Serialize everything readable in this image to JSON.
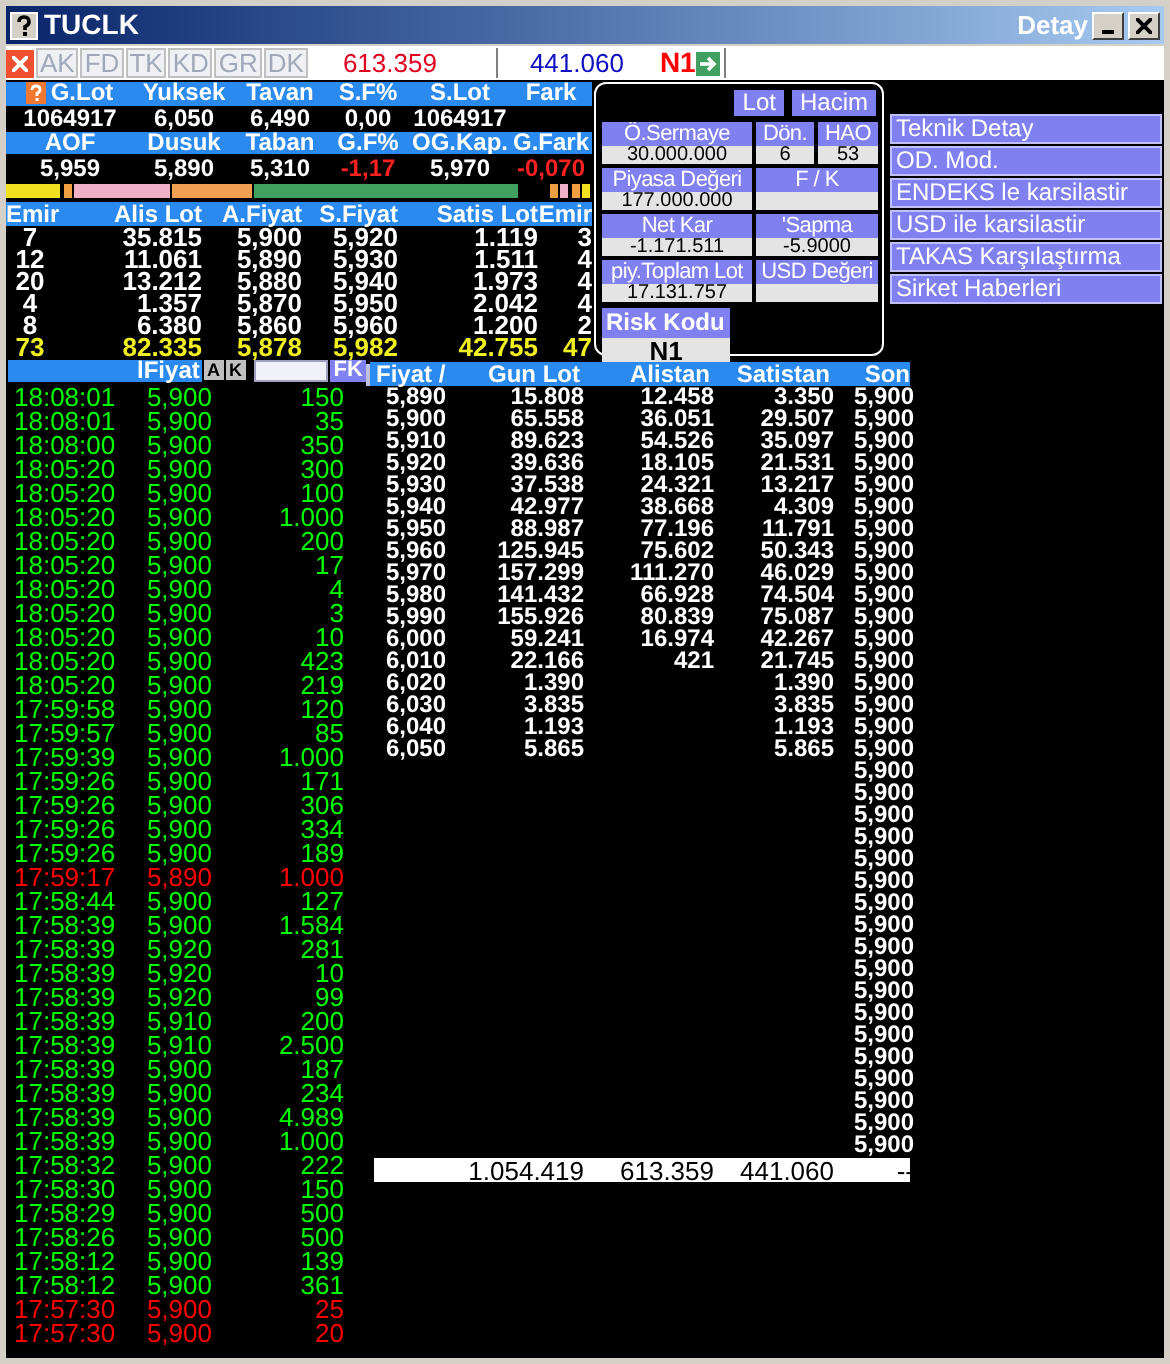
{
  "window": {
    "title": "TUCLK",
    "title_right": "Detay"
  },
  "toolbar": {
    "buttons": [
      {
        "label": "AK",
        "disabled": true
      },
      {
        "label": "FD",
        "disabled": true
      },
      {
        "label": "TK",
        "disabled": true
      },
      {
        "label": "KD",
        "disabled": true
      },
      {
        "label": "GR",
        "disabled": true
      },
      {
        "label": "DK",
        "disabled": true
      }
    ],
    "buy_total": "613.359",
    "sell_total": "441.060",
    "risk": "N1"
  },
  "stats_rows": [
    {
      "cells": [
        {
          "label": "G.Lot",
          "value": "1064917"
        },
        {
          "label": "Yuksek",
          "value": "6,050"
        },
        {
          "label": "Tavan",
          "value": "6,490"
        },
        {
          "label": "S.F%",
          "value": "0,00"
        },
        {
          "label": "S.Lot",
          "value": "1064917"
        },
        {
          "label": "Fark"
        }
      ]
    },
    {
      "cells": [
        {
          "label": "AOF",
          "value": "5,959",
          "color": "#ffffff"
        },
        {
          "label": "Dusuk",
          "value": "5,890",
          "color": "#ffffff"
        },
        {
          "label": "Taban",
          "value": "5,310",
          "color": "#ffffff"
        },
        {
          "label": "G.F%",
          "value": "-1,17",
          "color": "#ff2020"
        },
        {
          "label": "OG.Kap.",
          "value": "5,970",
          "color": "#ffffff"
        },
        {
          "label": "G.Fark",
          "value": "-0,070",
          "color": "#ff2020"
        }
      ]
    }
  ],
  "order_book": {
    "columns": [
      "Emir",
      "Alis Lot",
      "A.Fiyat",
      "S.Fiyat",
      "Satis Lot",
      "Emir"
    ],
    "rows": [
      {
        "kind": "level",
        "cells": [
          "7",
          "35.815",
          "5,900",
          "5,920",
          "1.119",
          "3"
        ]
      },
      {
        "kind": "level",
        "cells": [
          "12",
          "11.061",
          "5,890",
          "5,930",
          "1.511",
          "4"
        ]
      },
      {
        "kind": "level",
        "cells": [
          "20",
          "13.212",
          "5,880",
          "5,940",
          "1.973",
          "4"
        ]
      },
      {
        "kind": "level",
        "cells": [
          "4",
          "1.357",
          "5,870",
          "5,950",
          "2.042",
          "4"
        ]
      },
      {
        "kind": "level",
        "cells": [
          "8",
          "6.380",
          "5,860",
          "5,960",
          "1.200",
          "2"
        ]
      },
      {
        "kind": "total",
        "cells": [
          "73",
          "82.335",
          "5,878",
          "5,982",
          "42.755",
          "47"
        ]
      }
    ]
  },
  "detail_panel": {
    "toggles": [
      "Lot",
      "Hacim"
    ],
    "fields": [
      {
        "label": "Ö.Sermaye",
        "value": "30.000.000"
      },
      {
        "label": "Dön.",
        "value": "6"
      },
      {
        "label": "HAO",
        "value": "53"
      },
      {
        "label": "Piyasa Değeri",
        "value": "177.000.000"
      },
      {
        "label": "F / K"
      },
      {
        "label": "Net Kar",
        "value": "-1.171.511"
      },
      {
        "label": "'Sapma",
        "value": "-5.9000"
      },
      {
        "label": "piy.Toplam Lot",
        "value": "17.131.757"
      },
      {
        "label": "USD Değeri"
      }
    ],
    "risk": {
      "label": "Risk Kodu",
      "value": "N1"
    }
  },
  "menu": [
    "Teknik Detay",
    "OD. Mod.",
    "ENDEKS le karsilastir",
    "USD ile karsilastir",
    "TAKAS Karşılaştırma",
    "Sirket Haberleri"
  ],
  "trades": {
    "header": "lFiyat",
    "buttons": [
      "A",
      "K"
    ],
    "filter_button": "FK",
    "rows": [
      {
        "time": "18:08:01",
        "price": "5,900",
        "lot": "150",
        "color": "#00ff00"
      },
      {
        "time": "18:08:01",
        "price": "5,900",
        "lot": "35",
        "color": "#00ff00"
      },
      {
        "time": "18:08:00",
        "price": "5,900",
        "lot": "350",
        "color": "#00ff00"
      },
      {
        "time": "18:05:20",
        "price": "5,900",
        "lot": "300",
        "color": "#00ff00"
      },
      {
        "time": "18:05:20",
        "price": "5,900",
        "lot": "100",
        "color": "#00ff00"
      },
      {
        "time": "18:05:20",
        "price": "5,900",
        "lot": "1.000",
        "color": "#00ff00"
      },
      {
        "time": "18:05:20",
        "price": "5,900",
        "lot": "200",
        "color": "#00ff00"
      },
      {
        "time": "18:05:20",
        "price": "5,900",
        "lot": "17",
        "color": "#00ff00"
      },
      {
        "time": "18:05:20",
        "price": "5,900",
        "lot": "4",
        "color": "#00ff00"
      },
      {
        "time": "18:05:20",
        "price": "5,900",
        "lot": "3",
        "color": "#00ff00"
      },
      {
        "time": "18:05:20",
        "price": "5,900",
        "lot": "10",
        "color": "#00ff00"
      },
      {
        "time": "18:05:20",
        "price": "5,900",
        "lot": "423",
        "color": "#00ff00"
      },
      {
        "time": "18:05:20",
        "price": "5,900",
        "lot": "219",
        "color": "#00ff00"
      },
      {
        "time": "17:59:58",
        "price": "5,900",
        "lot": "120",
        "color": "#00ff00"
      },
      {
        "time": "17:59:57",
        "price": "5,900",
        "lot": "85",
        "color": "#00ff00"
      },
      {
        "time": "17:59:39",
        "price": "5,900",
        "lot": "1.000",
        "color": "#00ff00"
      },
      {
        "time": "17:59:26",
        "price": "5,900",
        "lot": "171",
        "color": "#00ff00"
      },
      {
        "time": "17:59:26",
        "price": "5,900",
        "lot": "306",
        "color": "#00ff00"
      },
      {
        "time": "17:59:26",
        "price": "5,900",
        "lot": "334",
        "color": "#00ff00"
      },
      {
        "time": "17:59:26",
        "price": "5,900",
        "lot": "189",
        "color": "#00ff00"
      },
      {
        "time": "17:59:17",
        "price": "5,890",
        "lot": "1.000",
        "color": "#ff0000"
      },
      {
        "time": "17:58:44",
        "price": "5,900",
        "lot": "127",
        "color": "#00ff00"
      },
      {
        "time": "17:58:39",
        "price": "5,900",
        "lot": "1.584",
        "color": "#00ff00"
      },
      {
        "time": "17:58:39",
        "price": "5,920",
        "lot": "281",
        "color": "#00ff00"
      },
      {
        "time": "17:58:39",
        "price": "5,920",
        "lot": "10",
        "color": "#00ff00"
      },
      {
        "time": "17:58:39",
        "price": "5,920",
        "lot": "99",
        "color": "#00ff00"
      },
      {
        "time": "17:58:39",
        "price": "5,910",
        "lot": "200",
        "color": "#00ff00"
      },
      {
        "time": "17:58:39",
        "price": "5,910",
        "lot": "2.500",
        "color": "#00ff00"
      },
      {
        "time": "17:58:39",
        "price": "5,900",
        "lot": "187",
        "color": "#00ff00"
      },
      {
        "time": "17:58:39",
        "price": "5,900",
        "lot": "234",
        "color": "#00ff00"
      },
      {
        "time": "17:58:39",
        "price": "5,900",
        "lot": "4.989",
        "color": "#00ff00"
      },
      {
        "time": "17:58:39",
        "price": "5,900",
        "lot": "1.000",
        "color": "#00ff00"
      },
      {
        "time": "17:58:32",
        "price": "5,900",
        "lot": "222",
        "color": "#00ff00"
      },
      {
        "time": "17:58:30",
        "price": "5,900",
        "lot": "150",
        "color": "#00ff00"
      },
      {
        "time": "17:58:29",
        "price": "5,900",
        "lot": "500",
        "color": "#00ff00"
      },
      {
        "time": "17:58:26",
        "price": "5,900",
        "lot": "500",
        "color": "#00ff00"
      },
      {
        "time": "17:58:12",
        "price": "5,900",
        "lot": "139",
        "color": "#00ff00"
      },
      {
        "time": "17:58:12",
        "price": "5,900",
        "lot": "361",
        "color": "#00ff00"
      },
      {
        "time": "17:57:30",
        "price": "5,900",
        "lot": "25",
        "color": "#ff0000"
      },
      {
        "time": "17:57:30",
        "price": "5,900",
        "lot": "20",
        "color": "#ff0000"
      }
    ]
  },
  "price_table": {
    "columns": [
      "Fiyat /",
      "Gun Lot",
      "Alistan",
      "Satistan",
      "Son"
    ],
    "rows": [
      {
        "fiyat": "5,890",
        "gun_lot": "15.808",
        "alistan": "12.458",
        "satistan": "3.350",
        "son": "5,900"
      },
      {
        "fiyat": "5,900",
        "gun_lot": "65.558",
        "alistan": "36.051",
        "satistan": "29.507",
        "son": "5,900"
      },
      {
        "fiyat": "5,910",
        "gun_lot": "89.623",
        "alistan": "54.526",
        "satistan": "35.097",
        "son": "5,900"
      },
      {
        "fiyat": "5,920",
        "gun_lot": "39.636",
        "alistan": "18.105",
        "satistan": "21.531",
        "son": "5,900"
      },
      {
        "fiyat": "5,930",
        "gun_lot": "37.538",
        "alistan": "24.321",
        "satistan": "13.217",
        "son": "5,900"
      },
      {
        "fiyat": "5,940",
        "gun_lot": "42.977",
        "alistan": "38.668",
        "satistan": "4.309",
        "son": "5,900"
      },
      {
        "fiyat": "5,950",
        "gun_lot": "88.987",
        "alistan": "77.196",
        "satistan": "11.791",
        "son": "5,900"
      },
      {
        "fiyat": "5,960",
        "gun_lot": "125.945",
        "alistan": "75.602",
        "satistan": "50.343",
        "son": "5,900"
      },
      {
        "fiyat": "5,970",
        "gun_lot": "157.299",
        "alistan": "111.270",
        "satistan": "46.029",
        "son": "5,900"
      },
      {
        "fiyat": "5,980",
        "gun_lot": "141.432",
        "alistan": "66.928",
        "satistan": "74.504",
        "son": "5,900"
      },
      {
        "fiyat": "5,990",
        "gun_lot": "155.926",
        "alistan": "80.839",
        "satistan": "75.087",
        "son": "5,900"
      },
      {
        "fiyat": "6,000",
        "gun_lot": "59.241",
        "alistan": "16.974",
        "satistan": "42.267",
        "son": "5,900"
      },
      {
        "fiyat": "6,010",
        "gun_lot": "22.166",
        "alistan": "421",
        "satistan": "21.745",
        "son": "5,900"
      },
      {
        "fiyat": "6,020",
        "gun_lot": "1.390",
        "satistan": "1.390",
        "son": "5,900"
      },
      {
        "fiyat": "6,030",
        "gun_lot": "3.835",
        "satistan": "3.835",
        "son": "5,900"
      },
      {
        "fiyat": "6,040",
        "gun_lot": "1.193",
        "satistan": "1.193",
        "son": "5,900"
      },
      {
        "fiyat": "6,050",
        "gun_lot": "5.865",
        "satistan": "5.865",
        "son": "5,900"
      },
      {
        "son": "5,900"
      },
      {
        "son": "5,900"
      },
      {
        "son": "5,900"
      },
      {
        "son": "5,900"
      },
      {
        "son": "5,900"
      },
      {
        "son": "5,900"
      },
      {
        "son": "5,900"
      },
      {
        "son": "5,900"
      },
      {
        "son": "5,900"
      },
      {
        "son": "5,900"
      },
      {
        "son": "5,900"
      },
      {
        "son": "5,900"
      },
      {
        "son": "5,900"
      },
      {
        "son": "5,900"
      },
      {
        "son": "5,900"
      },
      {
        "son": "5,900"
      },
      {
        "son": "5,900"
      },
      {
        "son": "5,900"
      }
    ],
    "totals": {
      "gun_lot": "1.054.419",
      "alistan": "613.359",
      "satistan": "441.060",
      "son": "--"
    }
  }
}
